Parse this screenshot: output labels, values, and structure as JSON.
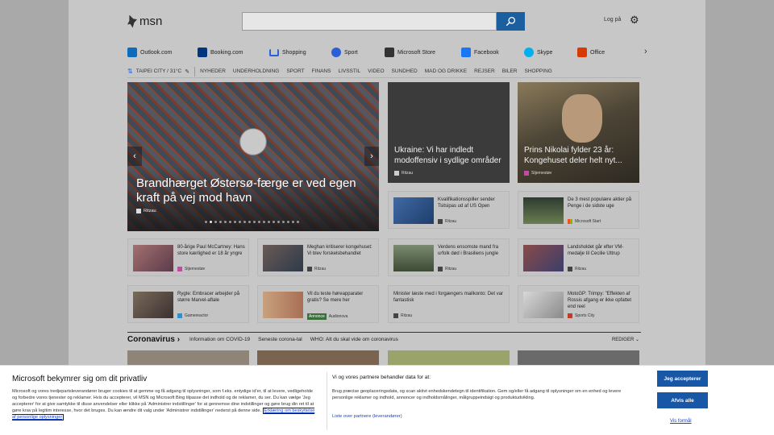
{
  "header": {
    "logo_text": "msn",
    "search_placeholder": "",
    "login_label": "Log på",
    "settings_icon": "gear-icon"
  },
  "quick_links": [
    {
      "label": "Outlook.com",
      "color": "#0f6cbd"
    },
    {
      "label": "Booking.com",
      "sub": "Booking.com",
      "color": "#003580"
    },
    {
      "label": "Shopping",
      "color": "#2b5fd9"
    },
    {
      "label": "Sport",
      "color": "#2b5fd9"
    },
    {
      "label": "Microsoft Store",
      "color": "#333333"
    },
    {
      "label": "Facebook",
      "color": "#1877f2"
    },
    {
      "label": "Skype",
      "color": "#00aff0"
    },
    {
      "label": "Office",
      "color": "#d83b01"
    }
  ],
  "nav": {
    "weather": "TAIPEI CITY / 31°C",
    "items": [
      "NYHEDER",
      "UNDERHOLDNING",
      "SPORT",
      "FINANS",
      "LIVSSTIL",
      "VIDEO",
      "SUNDHED",
      "MAD OG DRIKKE",
      "REJSER",
      "BILER",
      "SHOPPING"
    ]
  },
  "hero": {
    "title": "Brandhærget Østersø-færge er ved egen kraft på vej mod havn",
    "source": "Ritzau",
    "dots": 20,
    "active_dot": 1
  },
  "big_tiles": [
    {
      "title": "Ukraine: Vi har indledt modoffensiv i sydlige områder",
      "source": "Ritzau"
    },
    {
      "title": "Prins Nikolai fylder 23 år: Kongehuset deler helt nyt...",
      "source": "Stjernestøv"
    }
  ],
  "cards_right_top": [
    {
      "text": "Kvalifikationsspiller sender Tsitsipas ud af US Open",
      "source": "Ritzau"
    },
    {
      "text": "De 3 mest populære aktier på Penge i de sidste uge",
      "source": "Microsoft Start"
    }
  ],
  "cards_row1": [
    {
      "text": "80-årige Paul McCartney: Hans store kærlighed er 18 år yngre",
      "source": "Stjernestøv"
    },
    {
      "text": "Meghan kritiserer kongehuset: Vi blev forskelsbehandlet",
      "source": "Ritzau"
    },
    {
      "text": "Verdens ensomste mand fra urfolk død i Brasiliens jungle",
      "source": "Ritzau"
    },
    {
      "text": "Landsholdet går efter VM-medalje til Cecilie Uttrup",
      "source": "Ritzau"
    }
  ],
  "cards_row2": [
    {
      "text": "Rygte: Embracer arbejder på større Marvel-aftale",
      "source": "Gamereactor"
    },
    {
      "text": "Vil du teste høreapparater gratis? Se mere her",
      "source": "Audionova",
      "badge": "Annonce"
    },
    {
      "text": "Minister læste med i forgængers mailkonto: Det var fantastisk",
      "source": "Ritzau"
    },
    {
      "text": "MotoGP: Trimpy: \"Effekten af Rossis afgang er ikke opfattet end reel",
      "source": "Sports City"
    }
  ],
  "corona": {
    "heading": "Coronavirus",
    "links": [
      "Information om COVID-19",
      "Seneste corona-tal",
      "WHO: Alt du skal vide om coronavirus"
    ],
    "edit": "REDIGER"
  },
  "consent": {
    "title": "Microsoft bekymrer sig om dit privatliv",
    "body": "Microsoft og vores tredjepartsleverandører bruger cookies til at gemme og få adgang til oplysninger, som f.eks. entydige id'er, til at levere, vedligeholde og forbedre vores tjenester og reklamer. Hvis du accepterer, vil MSN og Microsoft Bing tilpasse det indhold og de reklamer, du ser. Du kan vælge 'Jeg accepterer' for at give samtykke til disse anvendelser eller klikke på 'Administrer indstillinger' for at gennemse dine indstillinger og gøre brug din ret til at gøre krav på legitim interesse, hvor det bruges. Du kan ændre dit valg under 'Administrer indstillinger' nederst på denne side.",
    "link": "Erklæring om beskyttelse af personlige oplysninger",
    "partners_title": "Vi og vores partnere behandler data for at:",
    "partners_body": "Brug præcise geoplaceringsdata, og scan aktivt enhedskendetegn til identifikation. Gem og/eller få adgang til oplysninger om en enhed og levere personlige reklamer og indhold, annoncer og indholdsmålinger, målgruppeindsigt og produktudvikling.",
    "partners_link": "Liste over partnere (leverandører)",
    "accept": "Jeg accepterer",
    "reject": "Afvis alle",
    "more": "Vis formål"
  }
}
